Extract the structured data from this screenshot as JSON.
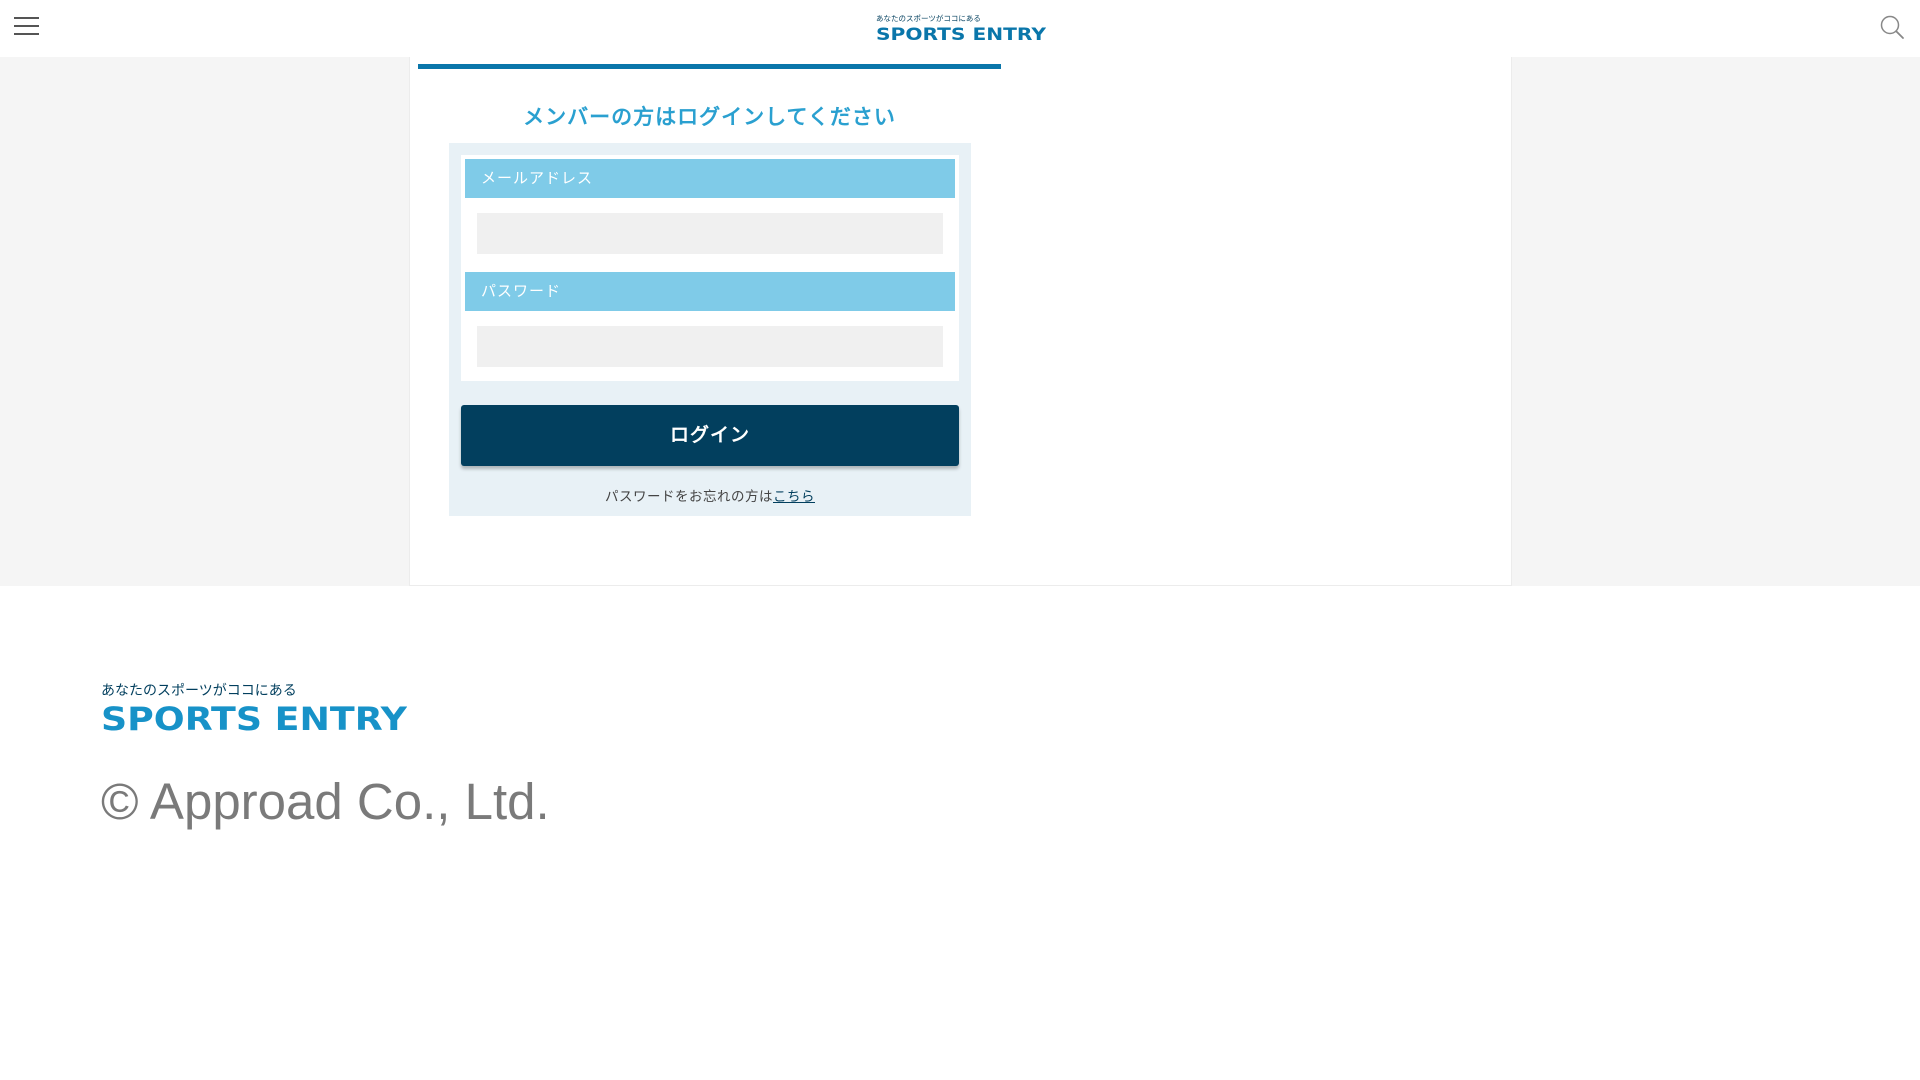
{
  "header": {
    "menu_icon": "hamburger-menu-icon",
    "logo": {
      "tagline": "あなたのスポーツがココにある",
      "name": "SPORTS ENTRY"
    },
    "search_icon": "search-icon"
  },
  "login": {
    "heading": "メンバーの方はログインしてください",
    "email_label": "メールアドレス",
    "email_value": "",
    "password_label": "パスワード",
    "password_value": "",
    "submit_label": "ログイン",
    "forgot_text": "パスワードをお忘れの方は",
    "forgot_link": "こちら"
  },
  "footer": {
    "logo": {
      "tagline": "あなたのスポーツがココにある",
      "name": "SPORTS ENTRY"
    },
    "copyright": "© Approad Co., Ltd."
  },
  "colors": {
    "brand_dark": "#023f5e",
    "brand_blue": "#0a76aa",
    "heading_blue": "#2aa0d0",
    "label_bg": "#7fcbe8",
    "panel_bg": "#e8f1f6"
  }
}
